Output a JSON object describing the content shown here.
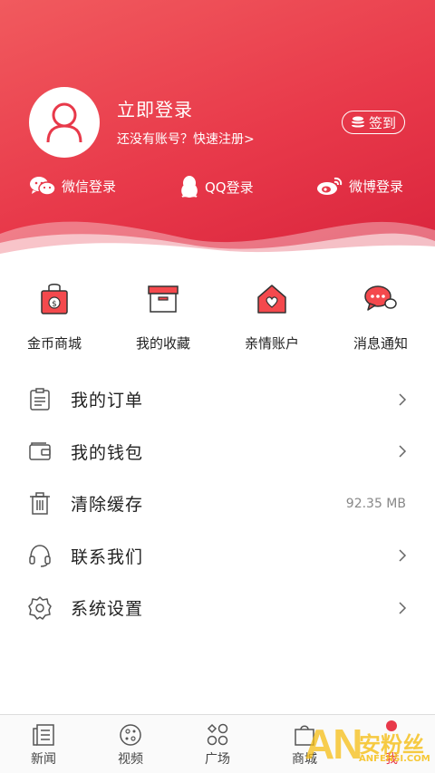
{
  "header": {
    "login_title": "立即登录",
    "login_subtitle": "还没有账号？快速注册>",
    "checkin_label": "签到",
    "social": [
      {
        "label": "微信登录",
        "icon": "wechat-icon"
      },
      {
        "label": "QQ登录",
        "icon": "qq-icon"
      },
      {
        "label": "微博登录",
        "icon": "weibo-icon"
      }
    ],
    "accent": "#e8394a"
  },
  "quick": [
    {
      "label": "金币商城",
      "icon": "coin-bag-icon"
    },
    {
      "label": "我的收藏",
      "icon": "box-icon"
    },
    {
      "label": "亲情账户",
      "icon": "heart-house-icon"
    },
    {
      "label": "消息通知",
      "icon": "chat-bubble-icon"
    }
  ],
  "menu": [
    {
      "label": "我的订单",
      "icon": "order-icon"
    },
    {
      "label": "我的钱包",
      "icon": "wallet-icon"
    },
    {
      "label": "清除缓存",
      "icon": "trash-icon",
      "value": "92.35 MB"
    },
    {
      "label": "联系我们",
      "icon": "headset-icon"
    },
    {
      "label": "系统设置",
      "icon": "settings-icon"
    }
  ],
  "tabs": [
    {
      "label": "新闻",
      "icon": "news-icon"
    },
    {
      "label": "视频",
      "icon": "video-icon"
    },
    {
      "label": "广场",
      "icon": "square-icon"
    },
    {
      "label": "商城",
      "icon": "shop-icon"
    },
    {
      "label": "我",
      "icon": "profile-icon",
      "active": true
    }
  ],
  "watermark": {
    "big": "AN",
    "cn": "安粉丝",
    "url": "ANFENSI.COM"
  }
}
